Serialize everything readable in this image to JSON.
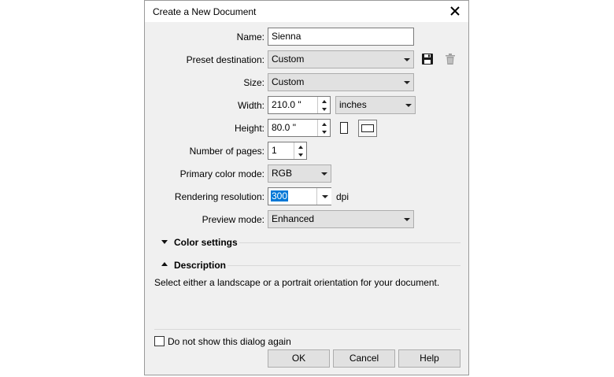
{
  "dialog": {
    "title": "Create a New Document",
    "close_icon": "close-icon"
  },
  "form": {
    "name_label": "Name:",
    "name_value": "Sienna",
    "preset_label": "Preset destination:",
    "preset_value": "Custom",
    "save_preset_icon": "save-icon",
    "delete_preset_icon": "trash-icon",
    "size_label": "Size:",
    "size_value": "Custom",
    "width_label": "Width:",
    "width_value": "210.0 \"",
    "units_value": "inches",
    "height_label": "Height:",
    "height_value": "80.0 \"",
    "portrait_icon": "portrait-orientation-icon",
    "landscape_icon": "landscape-orientation-icon",
    "pages_label": "Number of pages:",
    "pages_value": "1",
    "color_mode_label": "Primary color mode:",
    "color_mode_value": "RGB",
    "resolution_label": "Rendering resolution:",
    "resolution_value": "300",
    "resolution_unit": "dpi",
    "preview_label": "Preview mode:",
    "preview_value": "Enhanced"
  },
  "sections": {
    "color_settings": "Color settings",
    "description": "Description",
    "description_text": "Select either a landscape or a portrait orientation for your document."
  },
  "footer": {
    "checkbox_label": "Do not show this dialog again",
    "checkbox_checked": false,
    "ok": "OK",
    "cancel": "Cancel",
    "help": "Help"
  }
}
